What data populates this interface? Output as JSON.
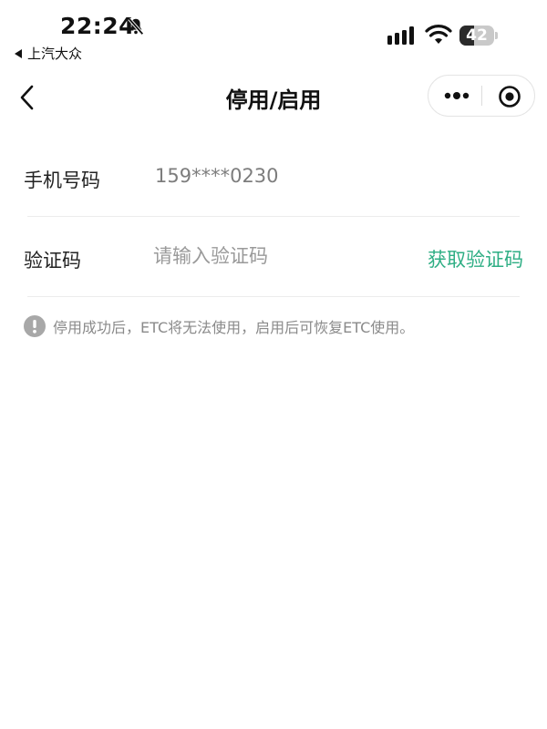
{
  "status_bar": {
    "time": "22:24",
    "back_app": "上汽大众",
    "battery_level": "42",
    "battery_fraction": 0.42,
    "icons": [
      "bell-slash-icon",
      "signal-icon",
      "wifi-icon",
      "battery-icon"
    ]
  },
  "nav": {
    "title": "停用/启用",
    "icons": [
      "chevron-left-icon",
      "more-icon",
      "target-icon"
    ]
  },
  "form": {
    "phone_label": "手机号码",
    "phone_value": "159****0230",
    "code_label": "验证码",
    "code_placeholder": "请输入验证码",
    "code_value": "",
    "get_code_label": "获取验证码"
  },
  "notice": {
    "icon": "exclamation-circle-icon",
    "text": "停用成功后，ETC将无法使用，启用后可恢复ETC使用。"
  },
  "colors": {
    "accent": "#2eae84",
    "label": "#222222",
    "muted": "#8a8a8a",
    "divider": "#ececec"
  }
}
